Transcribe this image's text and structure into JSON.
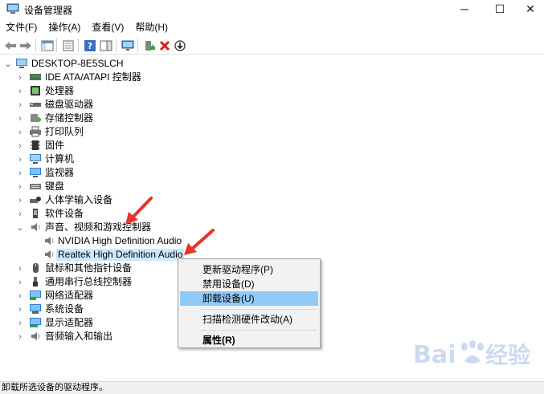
{
  "window": {
    "title": "设备管理器",
    "minimize_glyph": "─",
    "maximize_glyph": "☐",
    "close_glyph": "✕"
  },
  "menubar": {
    "items": [
      "文件(F)",
      "操作(A)",
      "查看(V)",
      "帮助(H)"
    ]
  },
  "toolbar": {
    "buttons": [
      {
        "name": "back-icon"
      },
      {
        "name": "forward-icon"
      },
      {
        "name": "show-hide-console-tree-icon"
      },
      {
        "name": "properties-icon"
      },
      {
        "name": "help-icon"
      },
      {
        "name": "action-pane-icon"
      },
      {
        "name": "monitor-icon"
      },
      {
        "name": "update-driver-icon"
      },
      {
        "name": "uninstall-x-icon"
      },
      {
        "name": "scan-download-icon"
      }
    ]
  },
  "tree": {
    "root": "DESKTOP-8E5SLCH",
    "items": [
      {
        "label": "IDE ATA/ATAPI 控制器",
        "icon": "ide-controller-icon"
      },
      {
        "label": "处理器",
        "icon": "processor-icon"
      },
      {
        "label": "磁盘驱动器",
        "icon": "disk-drive-icon"
      },
      {
        "label": "存储控制器",
        "icon": "storage-controller-icon"
      },
      {
        "label": "打印队列",
        "icon": "printer-icon"
      },
      {
        "label": "固件",
        "icon": "firmware-icon"
      },
      {
        "label": "计算机",
        "icon": "computer-icon"
      },
      {
        "label": "监视器",
        "icon": "monitor-icon"
      },
      {
        "label": "键盘",
        "icon": "keyboard-icon"
      },
      {
        "label": "人体学输入设备",
        "icon": "hid-icon"
      },
      {
        "label": "软件设备",
        "icon": "software-device-icon"
      },
      {
        "label": "声音、视频和游戏控制器",
        "icon": "speaker-icon"
      },
      {
        "label": "NVIDIA High Definition Audio",
        "icon": "speaker-icon"
      },
      {
        "label": "Realtek High Definition Audio",
        "icon": "speaker-icon"
      },
      {
        "label": "鼠标和其他指针设备",
        "icon": "mouse-icon"
      },
      {
        "label": "通用串行总线控制器",
        "icon": "usb-icon"
      },
      {
        "label": "网络适配器",
        "icon": "network-adapter-icon"
      },
      {
        "label": "系统设备",
        "icon": "system-device-icon"
      },
      {
        "label": "显示适配器",
        "icon": "display-adapter-icon"
      },
      {
        "label": "音频输入和输出",
        "icon": "speaker-icon"
      }
    ]
  },
  "context_menu": {
    "items": [
      "更新驱动程序(P)",
      "禁用设备(D)",
      "卸载设备(U)",
      "扫描检测硬件改动(A)",
      "属性(R)"
    ]
  },
  "status": {
    "text": "卸载所选设备的驱动程序。"
  },
  "colors": {
    "selection": "#cce8ff",
    "menu_highlight": "#91c9f7",
    "annotation_arrow": "#e8322b"
  }
}
